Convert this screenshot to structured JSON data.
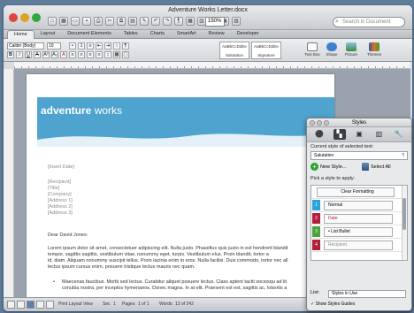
{
  "window": {
    "title": "Adventure Works Letter.docx"
  },
  "toolbar": {
    "zoom": "150%",
    "search_placeholder": "Search in Document"
  },
  "ribbon_tabs": [
    "Home",
    "Layout",
    "Document Elements",
    "Tables",
    "Charts",
    "SmartArt",
    "Review",
    "Developer"
  ],
  "ribbon": {
    "font_name": "Calibri (Body)",
    "font_size": "10",
    "style_cards": [
      {
        "sample": "AaBbCcDdEe",
        "name": "Salutation"
      },
      {
        "sample": "AaBbCcDdEe",
        "name": "Signature"
      }
    ],
    "tools": [
      "Text Box",
      "Shape",
      "Picture",
      "Themes"
    ]
  },
  "document": {
    "logo_a": "adventure",
    "logo_b": " works",
    "insert_date": "[Insert Date]",
    "recipient": [
      "[Recipient]",
      "[Title]",
      "[Company]",
      "[Address 1]",
      "[Address 2]",
      "[Address 3]"
    ],
    "greeting": "Dear David Jones:",
    "body": [
      "Lorem ipsum dolor sit amet, consectetuer adipiscing elit. Nulla justo. Phasellus quis justo in est hendrerit blandit",
      "tempor, sagittis sagittis, vestibulum vitae, nonummy eget, turpis. Vestibulum elus. Proin blandit, tortor a",
      "id, diam. Aliquam nonummy suscipit tellus. Proin lacinia enim in eros. Nulla facilisi. Duis commodo, tortor nec all",
      "lectus ipsum cursus enim, posuere tristique lectus mauris nec quam."
    ],
    "bullet": [
      "Maecenas faucibus. Morbi sed lectus. Curabitur aliquet posuere lectus. Class aptent taciti sociosqu ad lit",
      "conubia nostra, per inceptos hymenaeos. Donec magna. In at elit. Praesent est est, sagittis ac, lobortis a"
    ],
    "color_tabs": [
      {
        "label": "6",
        "color": "#1b6e9c"
      },
      {
        "label": "2",
        "color": "#b21f3a"
      },
      {
        "label": "3",
        "color": "#8a1d55"
      },
      {
        "label": "5",
        "color": "#c8901a"
      },
      {
        "label": "1",
        "color": "#2aa3dc"
      },
      {
        "label": "3",
        "color": "#4aa33a"
      }
    ]
  },
  "styles_panel": {
    "title": "Styles",
    "current_label": "Current style of selected text:",
    "current_style": "Salutation",
    "new_style": "New Style...",
    "select_all": "Select All",
    "pick_label": "Pick a style to apply:",
    "items": [
      {
        "num": "",
        "name": "Clear Formatting",
        "color": ""
      },
      {
        "num": "1",
        "name": "Normal",
        "color": "#2aa3dc"
      },
      {
        "num": "2",
        "name": "Date",
        "color": "#b21f3a"
      },
      {
        "num": "3",
        "name": "List Bullet",
        "color": "#4aa33a"
      },
      {
        "num": "4",
        "name": "Recipient",
        "color": "#b21f3a"
      }
    ],
    "list_label": "List:",
    "list_value": "Styles in Use",
    "show_guides": "Show Styles Guides"
  },
  "status": {
    "view": "Print Layout View",
    "sec": "Sec",
    "sec_val": "1",
    "pages": "Pages:",
    "pages_val": "1 of 1",
    "words": "Words:",
    "words_val": "13 of 242"
  }
}
